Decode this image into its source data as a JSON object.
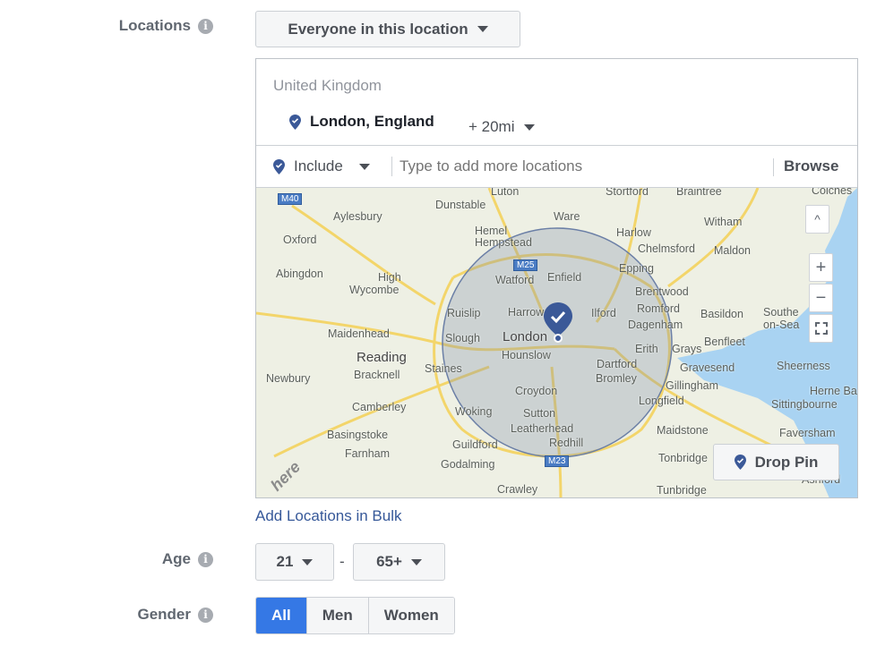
{
  "locations": {
    "label": "Locations",
    "info_icon": "i",
    "type_dropdown": "Everyone in this location",
    "country": "United Kingdom",
    "selected_location": "London, England",
    "radius": "+ 20mi",
    "include_dropdown": "Include",
    "search_placeholder": "Type to add more locations",
    "browse": "Browse",
    "add_bulk": "Add Locations in Bulk"
  },
  "map": {
    "road_badges": [
      "M40",
      "M25",
      "M23"
    ],
    "towns": [
      "Luton",
      "Dunstable",
      "Stortford",
      "Braintree",
      "Colches",
      "Aylesbury",
      "Ware",
      "Witham",
      "Oxford",
      "Hemel",
      "Hempstead",
      "Harlow",
      "Chelmsford",
      "Maldon",
      "Abingdon",
      "High",
      "Wycombe",
      "Watford",
      "Enfield",
      "Epping",
      "Brentwood",
      "Ruislip",
      "Harrow",
      "Ilford",
      "Romford",
      "Basildon",
      "Southe",
      "on-Sea",
      "Dagenham",
      "Maidenhead",
      "Slough",
      "London",
      "Benfleet",
      "Erith",
      "Grays",
      "Reading",
      "Hounslow",
      "Staines",
      "Dartford",
      "Sheerness",
      "Gravesend",
      "Newbury",
      "Bracknell",
      "Bromley",
      "Gillingham",
      "Croydon",
      "Herne Ba",
      "Longfield",
      "Sittingbourne",
      "Camberley",
      "Woking",
      "Sutton",
      "Leatherhead",
      "Maidstone",
      "Basingstoke",
      "Faversham",
      "Guildford",
      "Redhill",
      "Farnham",
      "Tonbridge",
      "Godalming",
      "Crawley",
      "Tunbridge",
      "Ashford"
    ],
    "logo": "here",
    "drop_pin": "Drop Pin",
    "zoom_in": "+",
    "zoom_out": "−",
    "collapse": "^"
  },
  "age": {
    "label": "Age",
    "min": "21",
    "separator": "-",
    "max": "65+"
  },
  "gender": {
    "label": "Gender",
    "options": [
      "All",
      "Men",
      "Women"
    ],
    "selected": "All"
  },
  "colors": {
    "accent": "#3578e5",
    "pin": "#3b5998",
    "link": "#365899",
    "water": "#a9d3f2"
  }
}
